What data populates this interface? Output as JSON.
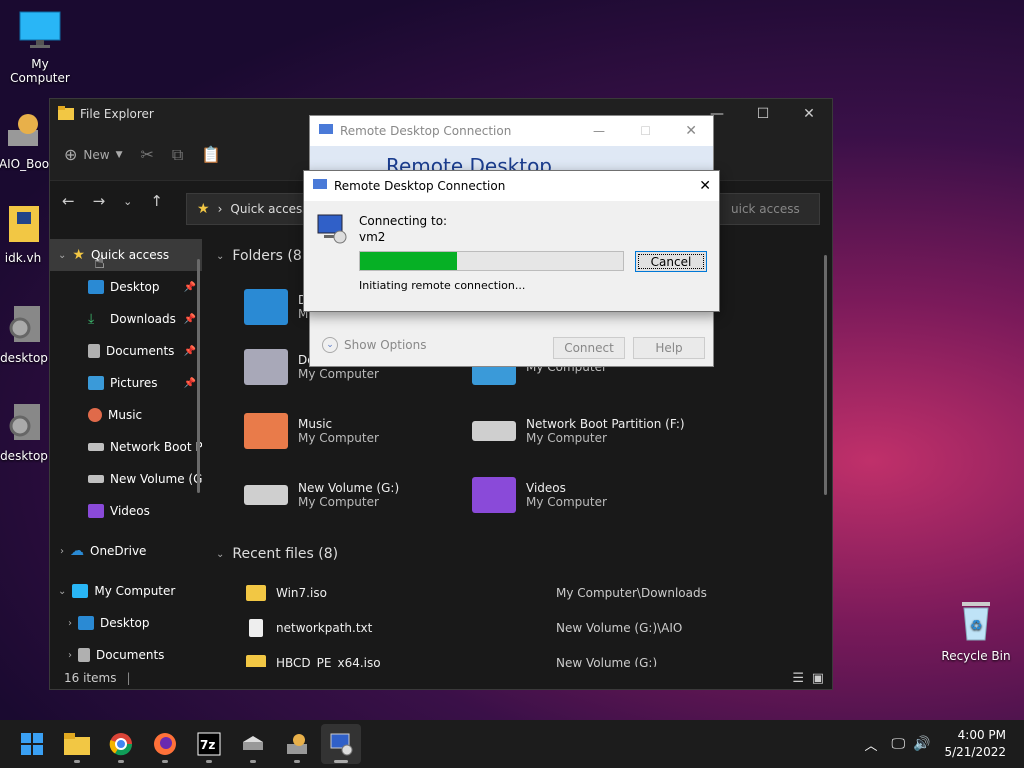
{
  "desktop": {
    "icons": [
      {
        "label": "My Computer"
      },
      {
        "label": "AIO_Boo"
      },
      {
        "label": "idk.vh"
      },
      {
        "label": "desktop"
      },
      {
        "label": "desktop"
      },
      {
        "label": "Recycle Bin"
      }
    ]
  },
  "explorer": {
    "title": "File Explorer",
    "toolbar": {
      "new_label": "New"
    },
    "address": {
      "path": "Quick access",
      "search_placeholder": "Search Quick access",
      "search_visible": "uick access"
    },
    "nav": {
      "quick_access": "Quick access",
      "items": [
        {
          "label": "Desktop",
          "pinned": true,
          "color": "#2a8ad4"
        },
        {
          "label": "Downloads",
          "pinned": true,
          "color": "#3dbb6e"
        },
        {
          "label": "Documents",
          "pinned": true,
          "color": "#b0b0b0"
        },
        {
          "label": "Pictures",
          "pinned": true,
          "color": "#3a9ad9"
        },
        {
          "label": "Music",
          "pinned": false,
          "color": "#e06a4a"
        },
        {
          "label": "Network Boot P",
          "pinned": false,
          "color": "#c0c0c0"
        },
        {
          "label": "New Volume (G",
          "pinned": false,
          "color": "#c0c0c0"
        },
        {
          "label": "Videos",
          "pinned": false,
          "color": "#8a4ad9"
        }
      ],
      "onedrive": "OneDrive",
      "my_computer": "My Computer",
      "mc_items": [
        "Desktop",
        "Documents"
      ]
    },
    "folders_header": "Folders (8)",
    "folders": [
      {
        "name": "D",
        "location": "M"
      },
      {
        "name": "Do",
        "location": "My Computer"
      },
      {
        "name": "",
        "location": "My Computer"
      },
      {
        "name": "Music",
        "location": "My Computer"
      },
      {
        "name": "Network Boot Partition (F:)",
        "location": "My Computer"
      },
      {
        "name": "New Volume (G:)",
        "location": "My Computer"
      },
      {
        "name": "Videos",
        "location": "My Computer"
      }
    ],
    "recent_header": "Recent files (8)",
    "recent": [
      {
        "name": "Win7.iso",
        "location": "My Computer\\Downloads"
      },
      {
        "name": "networkpath.txt",
        "location": "New Volume (G:)\\AIO"
      },
      {
        "name": "HBCD_PE_x64.iso",
        "location": "New Volume (G:)"
      }
    ],
    "status": "16 items"
  },
  "rdc_back": {
    "title": "Remote Desktop Connection",
    "banner": "Remote Desktop",
    "show_options": "Show Options",
    "connect": "Connect",
    "help": "Help"
  },
  "rdc_dialog": {
    "title": "Remote Desktop Connection",
    "connecting_to": "Connecting to:",
    "host": "vm2",
    "progress": 0.37,
    "status": "Initiating remote connection...",
    "cancel": "Cancel"
  },
  "taskbar": {
    "apps": [
      "start-icon",
      "file-explorer-icon",
      "chrome-icon",
      "firefox-icon",
      "7zip-icon",
      "drive-icon",
      "aio-boot-icon",
      "remote-desktop-icon"
    ],
    "time": "4:00 PM",
    "date": "5/21/2022"
  }
}
